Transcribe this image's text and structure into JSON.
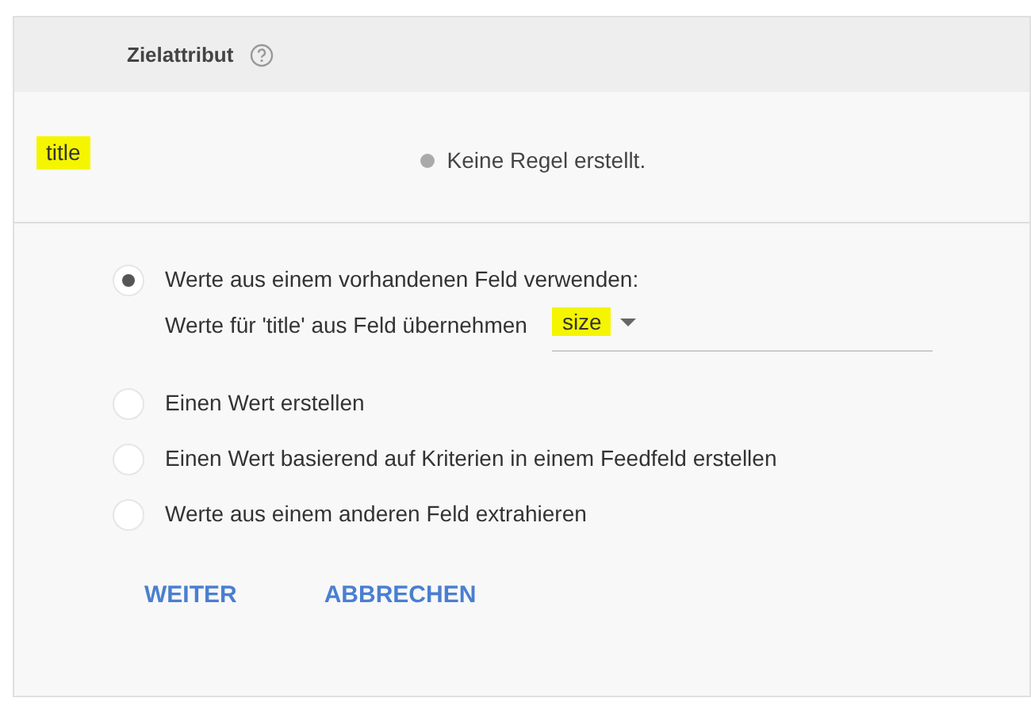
{
  "header": {
    "column_title": "Zielattribut"
  },
  "attribute_row": {
    "name": "title",
    "highlighted": true,
    "status": "Keine Regel erstellt."
  },
  "options": [
    {
      "kind": "field_select",
      "label": "Werte aus einem vorhandenen Feld verwenden:",
      "detail": "Werte für 'title' aus Feld übernehmen",
      "field": {
        "value": "size",
        "highlighted": true
      },
      "selected": true
    },
    {
      "kind": "plain",
      "label": "Einen Wert erstellen",
      "selected": false
    },
    {
      "kind": "plain",
      "label": "Einen Wert basierend auf Kriterien in einem Feedfeld erstellen",
      "selected": false
    },
    {
      "kind": "plain",
      "label": "Werte aus einem anderen Feld extrahieren",
      "selected": false
    }
  ],
  "buttons": [
    "WEITER",
    "ABBRECHEN"
  ]
}
